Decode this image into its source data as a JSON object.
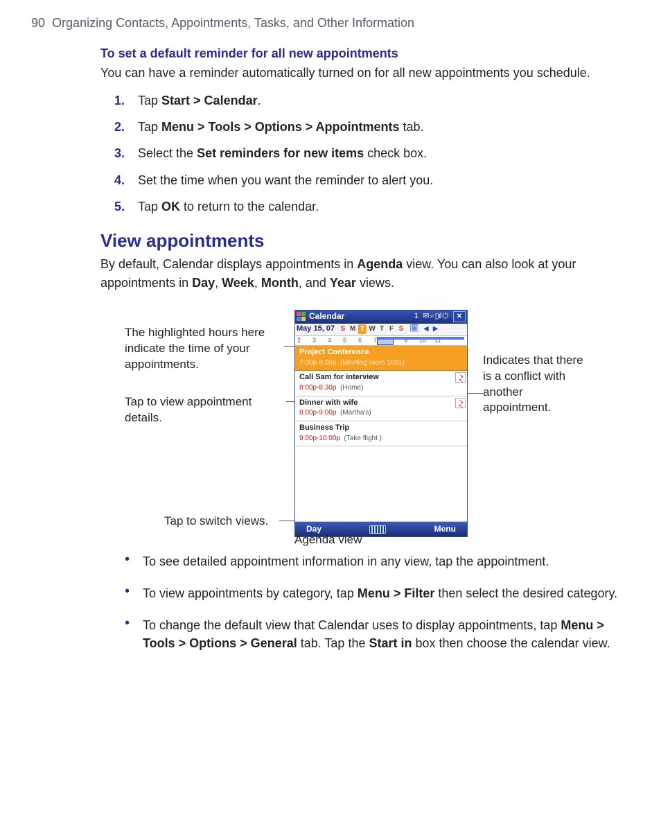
{
  "header": {
    "pageNumber": "90",
    "chapter": "Organizing Contacts, Appointments, Tasks, and Other Information"
  },
  "subheading1": "To set a default reminder for all new appointments",
  "para1": "You can have a reminder automatically turned on for all new appointments you schedule.",
  "steps": {
    "s1a": "Tap ",
    "s1b": "Start > Calendar",
    "s1c": ".",
    "s2a": "Tap ",
    "s2b": "Menu > Tools > Options > Appointments",
    "s2c": " tab.",
    "s3a": "Select the ",
    "s3b": "Set reminders for new items",
    "s3c": " check box.",
    "s4": "Set the time when you want the reminder to alert you.",
    "s5a": "Tap ",
    "s5b": "OK",
    "s5c": " to return to the calendar."
  },
  "h2": "View appointments",
  "para2a": "By default, Calendar displays appointments in ",
  "para2b": "Agenda",
  "para2c": " view. You can also look at your appointments in ",
  "para2d": "Day",
  "para2e": ", ",
  "para2f": "Week",
  "para2g": ", ",
  "para2h": "Month",
  "para2i": ", and ",
  "para2j": "Year",
  "para2k": " views.",
  "callouts": {
    "left1": "The highlighted hours here indicate the time of your appointments.",
    "left2": "Tap to view appointment details.",
    "left3": "Tap to switch views.",
    "right1": "Indicates that there is a conflict with another appointment."
  },
  "phone": {
    "title": "Calendar",
    "trayNum": "1",
    "date": "May 15, 07",
    "dow": {
      "S1": "S",
      "M": "M",
      "T1": "T",
      "W": "W",
      "T2": "T",
      "F": "F",
      "S2": "S"
    },
    "hours": [
      "2",
      "3",
      "4",
      "5",
      "6",
      "7",
      "8",
      "9",
      "10",
      "11"
    ],
    "items": [
      {
        "title": "Project Conference",
        "time": "7:00p-8:00p",
        "loc": "(Meeting room 1001)",
        "selected": true,
        "conflict": false
      },
      {
        "title": "Call Sam for interview",
        "time": "8:00p-8:30p",
        "loc": "(Home)",
        "selected": false,
        "conflict": true
      },
      {
        "title": "Dinner with wife",
        "time": "8:00p-9:00p",
        "loc": "(Martha's)",
        "selected": false,
        "conflict": true
      },
      {
        "title": "Business Trip",
        "time": "9:00p-10:00p",
        "loc": "(Take flight )",
        "selected": false,
        "conflict": false
      }
    ],
    "softLeft": "Day",
    "softRight": "Menu"
  },
  "figCaption": "Agenda view",
  "bullets": {
    "b1": "To see detailed appointment information in any view, tap the appointment.",
    "b2a": "To view appointments by category, tap ",
    "b2b": "Menu > Filter",
    "b2c": " then select the desired category.",
    "b3a": "To change the default view that Calendar uses to display appointments, tap ",
    "b3b": "Menu > Tools > Options > General",
    "b3c": " tab. Tap the ",
    "b3d": "Start in",
    "b3e": " box then choose the calendar view."
  }
}
